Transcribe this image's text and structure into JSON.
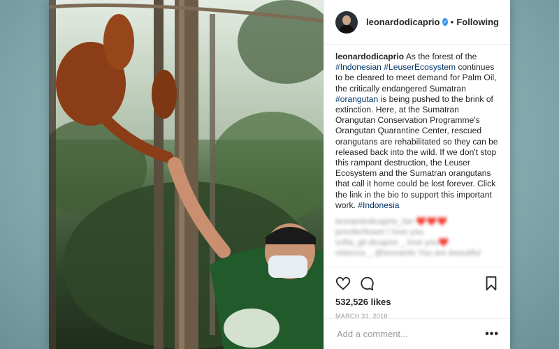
{
  "post": {
    "username": "leonardodicaprio",
    "verified_icon": "verified-badge-icon",
    "separator": "•",
    "follow_state": "Following",
    "caption": {
      "segments": [
        {
          "text": "As the forest of the ",
          "tag": false
        },
        {
          "text": "#Indonesian",
          "tag": true
        },
        {
          "text": " ",
          "tag": false
        },
        {
          "text": "#LeuserEcosystem",
          "tag": true
        },
        {
          "text": " continues to be cleared to meet demand for Palm Oil, the critically endangered Sumatran ",
          "tag": false
        },
        {
          "text": "#orangutan",
          "tag": true
        },
        {
          "text": " is being pushed to the brink of extinction. Here, at the Sumatran Orangutan Conservation Programme's Orangutan Quarantine Center, rescued orangutans are rehabilitated so they can be released back into the wild. If we don't stop this rampant destruction, the Leuser Ecosystem and the Sumatran orangutans that call it home could be lost forever. Click the link in the bio to support this important work. ",
          "tag": false
        },
        {
          "text": "#Indonesia",
          "tag": true
        }
      ]
    },
    "blurred_comments": [
      "leonardodicaprio_fan  ❤️❤️❤️",
      "jenniferflower  I love you",
      "sofia_gil  dicaprio  _ love you❤️",
      "rebecca  _ @leonardo  You are beautiful"
    ],
    "likes": "532,526 likes",
    "date": "MARCH 31, 2016",
    "comment_placeholder": "Add a comment...",
    "more_label": "•••"
  },
  "icons": {
    "like": "heart-icon",
    "comment": "comment-bubble-icon",
    "save": "bookmark-icon"
  },
  "colors": {
    "hashtag": "#003569",
    "verified": "#3897f0",
    "text": "#262626",
    "muted": "#999999"
  }
}
